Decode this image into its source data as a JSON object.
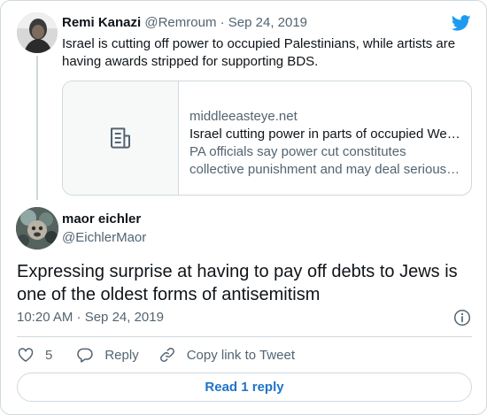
{
  "parent": {
    "name": "Remi Kanazi",
    "meta": "@Remroum · Sep 24, 2019",
    "text": "Israel is cutting off power to occupied Palestinians, while artists are having awards stripped for supporting BDS.",
    "link_card": {
      "domain": "middleeasteye.net",
      "title": "Israel cutting power in parts of occupied We…",
      "description": "PA officials say power cut constitutes collective punishment and may deal serious…",
      "thumbnail_icon": "document-icon"
    }
  },
  "tweet": {
    "name": "maor eichler",
    "handle": "@EichlerMaor",
    "text": "Expressing surprise at having to pay off debts to Jews is one of the oldest forms of antisemitism",
    "timestamp": "10:20 AM · Sep 24, 2019"
  },
  "actions": {
    "like_count": "5",
    "reply_label": "Reply",
    "copy_link_label": "Copy link to Tweet"
  },
  "read_reply_label": "Read 1 reply",
  "colors": {
    "brand": "#1d9bf0",
    "link_button": "#1d74c8",
    "muted_text": "#536471",
    "border": "#cfd9de"
  }
}
